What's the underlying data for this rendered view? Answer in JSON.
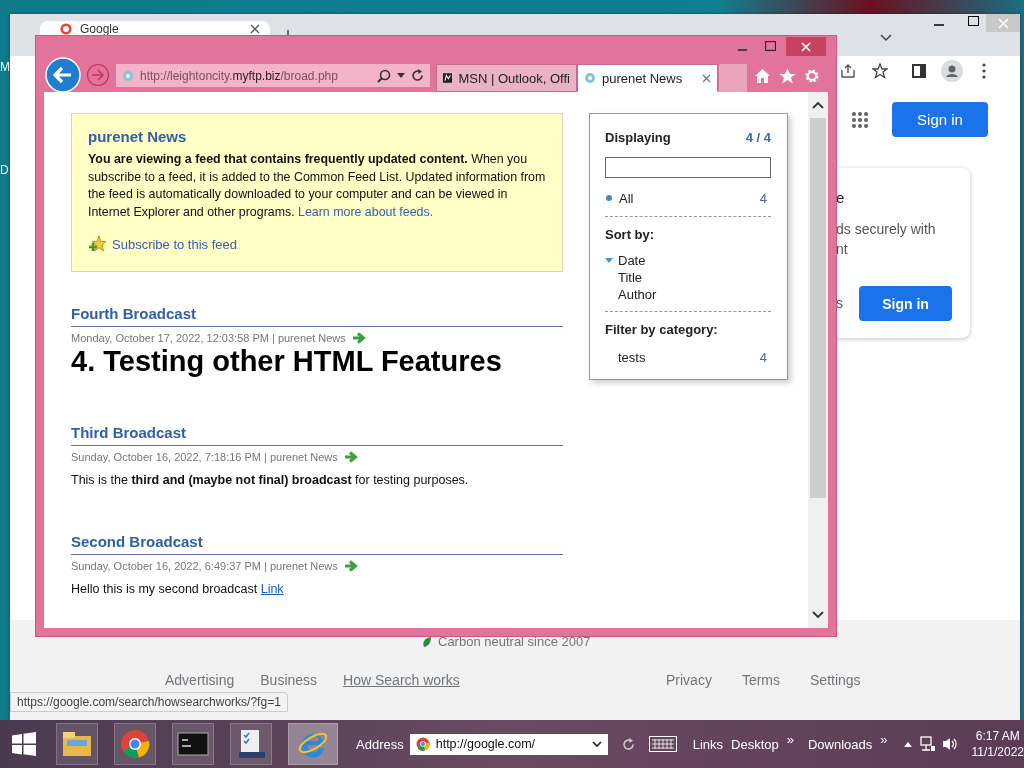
{
  "desktop": {
    "icon_labels": [
      "M",
      "D"
    ]
  },
  "chrome": {
    "tab": {
      "title": "Google"
    },
    "header_button": "Sign in",
    "card": {
      "lines": [
        "e",
        "ds securely with",
        "nt"
      ],
      "side_text": "s",
      "button": "Sign in"
    },
    "footer": {
      "carbon": "Carbon neutral since 2007",
      "left_links": [
        {
          "label": "Advertising",
          "hovered": false
        },
        {
          "label": "Business",
          "hovered": false
        },
        {
          "label": "How Search works",
          "hovered": true
        }
      ],
      "right_links": [
        {
          "label": "Privacy",
          "hovered": false
        },
        {
          "label": "Terms",
          "hovered": false
        },
        {
          "label": "Settings",
          "hovered": false
        }
      ]
    },
    "status_url": "https://google.com/search/howsearchworks/?fg=1"
  },
  "ie": {
    "url": {
      "prefix": "http://leightoncity.",
      "domain": "myftp.biz",
      "path": "/broad.php"
    },
    "tabs": [
      {
        "title": "MSN | Outlook, Offi",
        "selected": false
      },
      {
        "title": "purenet News",
        "selected": true
      }
    ],
    "feed": {
      "title": "purenet News",
      "description": "**You are viewing a feed that contains frequently updated content.** When you subscribe to a feed, it is added to the Common Feed List. Updated information from the feed is automatically downloaded to your computer and can be viewed in Internet Explorer and other programs.",
      "learn_more": "Learn more about feeds.",
      "subscribe": "Subscribe to this feed",
      "items": [
        {
          "title": "Fourth Broadcast",
          "meta": "Monday, October 17, 2022, 12:03:58 PM | purenet News",
          "body": {
            "kind": "heading",
            "text": "4. Testing other HTML Features"
          }
        },
        {
          "title": "Third Broadcast",
          "meta": "Sunday, October 16, 2022, 7:18:16 PM | purenet News",
          "body": {
            "kind": "text",
            "text": "This is the **third and (maybe not final) broadcast** for testing purposes."
          }
        },
        {
          "title": "Second Broadcast",
          "meta": "Sunday, October 16, 2022, 6:49:37 PM | purenet News",
          "body": {
            "kind": "text",
            "text": "Hello this is my second broadcast",
            "link": "Link"
          }
        }
      ]
    },
    "sidebar": {
      "displaying": "Displaying",
      "count": "4 / 4",
      "filters": [
        {
          "label": "All",
          "count": "4",
          "selected": true
        }
      ],
      "sort_label": "Sort by:",
      "sort_options": [
        {
          "label": "Date",
          "selected": true
        },
        {
          "label": "Title",
          "selected": false
        },
        {
          "label": "Author",
          "selected": false
        }
      ],
      "category_label": "Filter by category:",
      "categories": [
        {
          "label": "tests",
          "count": "4"
        }
      ]
    }
  },
  "taskbar": {
    "apps": [
      {
        "kind": "explorer",
        "active": false
      },
      {
        "kind": "chrome",
        "active": false
      },
      {
        "kind": "terminal",
        "active": false
      },
      {
        "kind": "tasklist",
        "active": false
      },
      {
        "kind": "ie",
        "active": true
      }
    ],
    "address_label": "Address",
    "address_value": "http://google.com/",
    "toolbars": [
      {
        "label": "Links"
      },
      {
        "label": "Desktop",
        "chevron": "»"
      },
      {
        "label": "Downloads",
        "chevron": "»"
      }
    ],
    "time": "6:17 AM",
    "date": "11/1/2022"
  }
}
